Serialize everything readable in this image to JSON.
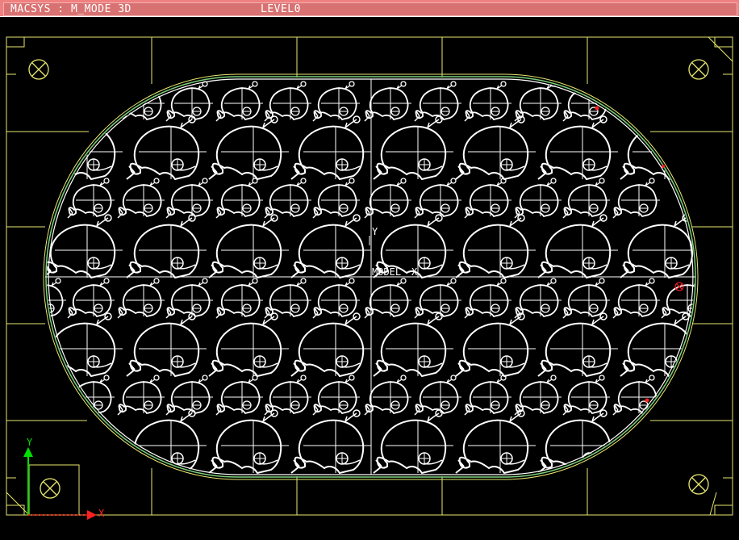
{
  "titlebar": {
    "macsys_label": "MACSYS : M_MODE 3D",
    "level_label": "LEVEL0"
  },
  "axes": {
    "model_y": "Y",
    "model_label": "MODEL",
    "model_x": "X",
    "triad_y": "Y",
    "triad_x": "X"
  },
  "colors": {
    "titlebar": "#f08080",
    "frame": "#e8e870",
    "part_outline": "#7ad07a",
    "geometry": "#ffffff",
    "triad_y": "#00e000",
    "triad_x": "#ff2020",
    "markers": "#ff2020"
  },
  "icons": {
    "whale": "whale-shape-icon",
    "hole": "crossed-circle-icon",
    "triad": "axis-triad-icon"
  }
}
